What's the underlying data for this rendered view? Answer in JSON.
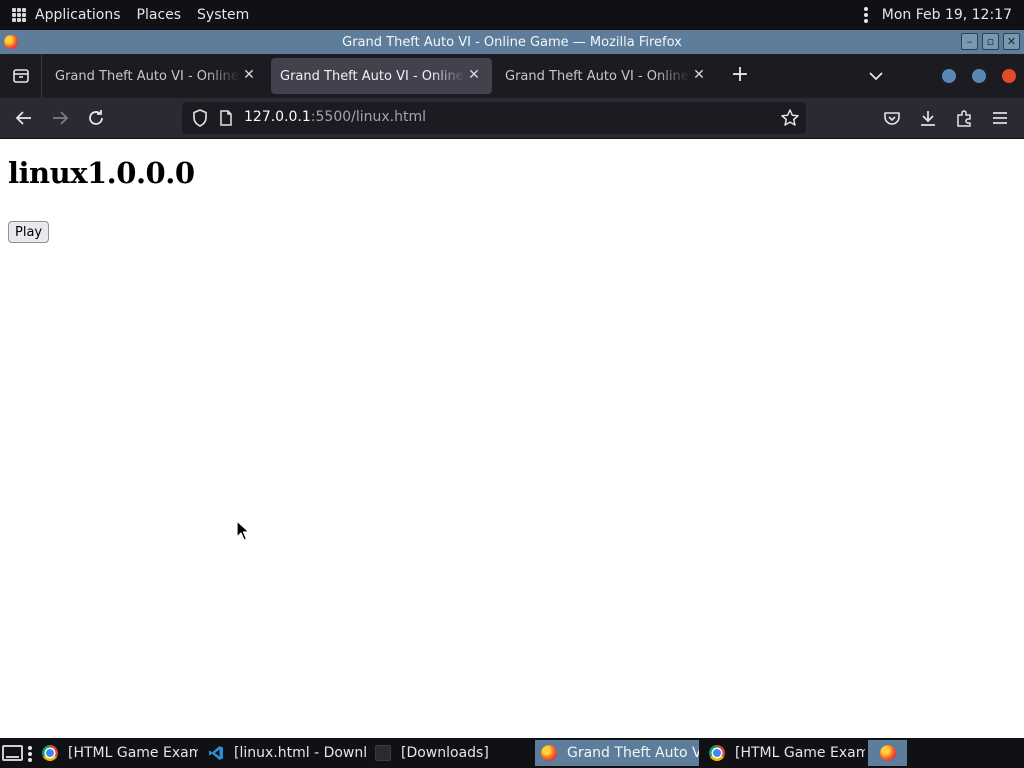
{
  "desktop": {
    "menu": {
      "applications": "Applications",
      "places": "Places",
      "system": "System"
    },
    "clock": "Mon Feb 19, 12:17"
  },
  "window": {
    "title": "Grand Theft Auto VI - Online Game — Mozilla Firefox"
  },
  "tabs": [
    {
      "label": "Grand Theft Auto VI - Online Game",
      "active": false
    },
    {
      "label": "Grand Theft Auto VI - Online Game",
      "active": true
    },
    {
      "label": "Grand Theft Auto VI - Online Game",
      "active": false
    }
  ],
  "tab_dot_colors": [
    "#5b87b5",
    "#5b87b5",
    "#e24c2e"
  ],
  "toolbar": {
    "url_host": "127.0.0.1",
    "url_rest": ":5500/linux.html"
  },
  "page": {
    "heading": "linux1.0.0.0",
    "play_label": "Play"
  },
  "taskbar": {
    "tasks": [
      {
        "label": "[HTML Game Exam...",
        "icon": "chrome-icon",
        "active": false
      },
      {
        "label": "[linux.html - Downl...",
        "icon": "vscode-icon",
        "active": false
      },
      {
        "label": "[Downloads]",
        "icon": "folder-icon",
        "active": false
      },
      {
        "label": "Grand Theft Auto VI...",
        "icon": "firefox-icon",
        "active": true
      },
      {
        "label": "[HTML Game Exam...",
        "icon": "chrome-icon",
        "active": false
      },
      {
        "label": "",
        "icon": "firefox-icon",
        "active": true
      }
    ]
  }
}
